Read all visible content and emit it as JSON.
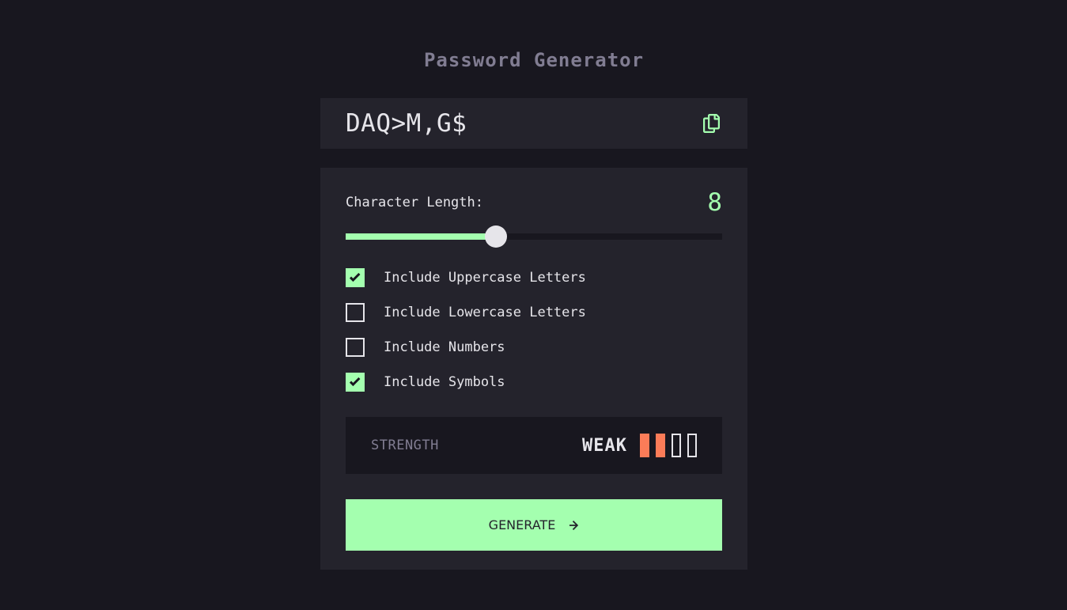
{
  "app": {
    "title": "Password Generator"
  },
  "output": {
    "password": "DAQ>M,G$",
    "copy_icon": "copy-icon"
  },
  "length": {
    "label": "Character Length:",
    "value": "8",
    "slider_fraction": 0.4
  },
  "options": [
    {
      "label": "Include Uppercase Letters",
      "checked": true
    },
    {
      "label": "Include Lowercase Letters",
      "checked": false
    },
    {
      "label": "Include Numbers",
      "checked": false
    },
    {
      "label": "Include Symbols",
      "checked": true
    }
  ],
  "strength": {
    "label": "STRENGTH",
    "rating": "WEAK",
    "level": 2,
    "max": 4
  },
  "generate": {
    "label": "GENERATE",
    "icon": "arrow-right-icon"
  },
  "colors": {
    "accent": "#a4ffaf",
    "weak": "#fb7c58",
    "background": "#18171f",
    "panel": "#24232c"
  }
}
